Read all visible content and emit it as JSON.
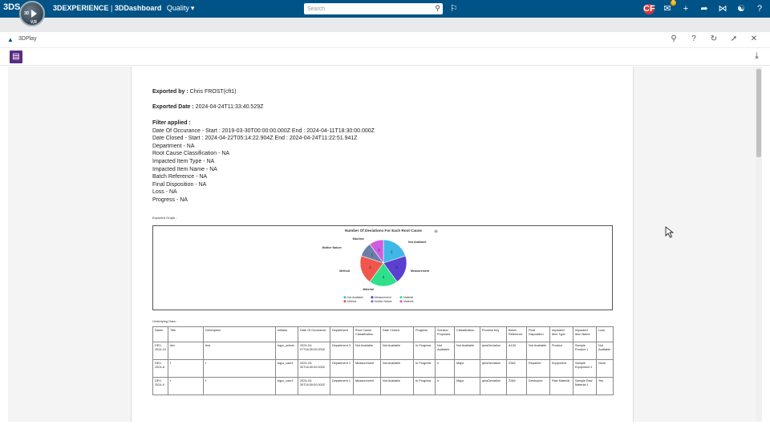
{
  "topbar": {
    "logo": "3DS",
    "compass": {
      "label_3d": "3D",
      "label_v": "V,R"
    },
    "title_brand": "3DEXPERIENCE",
    "title_sep": " | ",
    "title_app": "3DDashboard",
    "title_context": "Quality",
    "search_placeholder": "Search",
    "avatar_initials": "CF",
    "notification_count": "5"
  },
  "widget": {
    "title": "3DPlay"
  },
  "report": {
    "exported_by_label": "Exported by :",
    "exported_by_value": " Chris FROST(cft1)",
    "exported_date_label": "Exported Date :",
    "exported_date_value": " 2024-04-24T11:33:40.529Z",
    "filter_label": "Filter applied :",
    "filters": [
      "Date Of Occurance - Start : 2019-03-30T00:00:00.000Z End : 2024-04-11T18:30:00.000Z",
      "Date Closed - Start : 2024-04-22T05:14:22.904Z End : 2024-04-24T11:22:51.941Z",
      "Department - NA",
      "Root Cause Classification - NA",
      "Impacted Item Type - NA",
      "Impacted Item Name - NA",
      "Batch Reference - NA",
      "Final Disposition - NA",
      "Loss - NA",
      "Progress - NA"
    ],
    "graph_label": "Exported Graph :",
    "data_label": "Underlying Data :"
  },
  "chart_data": {
    "type": "pie",
    "title": "Number Of Deviations For Each Root Cause",
    "menu_icon": "hamburger-icon",
    "slices": [
      {
        "name": "Not Available",
        "value": 2,
        "color": "#3fb8e8"
      },
      {
        "name": "Measurement",
        "value": 2,
        "color": "#5b3fd0"
      },
      {
        "name": "Material",
        "value": 2,
        "color": "#2fe08a"
      },
      {
        "name": "Method",
        "value": 2,
        "color": "#f0564c"
      },
      {
        "name": "Mother Nature",
        "value": 1,
        "color": "#6a7fa8"
      },
      {
        "name": "Machine",
        "value": 1,
        "color": "#cf5ce0"
      }
    ],
    "legend_position": "bottom"
  },
  "table": {
    "headers": [
      "Name",
      "Title",
      "Description",
      "Initiator",
      "Date Of Occurance",
      "Department",
      "Root Cause Classification",
      "Date Closed",
      "Progress",
      "Solution Proposed",
      "Classification",
      "Process Key",
      "Batch Reference",
      "Final Disposition",
      "Impacted Item Type",
      "Impacted Item Name",
      "Loss"
    ],
    "rows": [
      [
        "DEV-2024-10",
        "dev",
        "test",
        "bqpc_admin",
        "2024-04-07T18:30:00.000Z",
        "Department 3",
        "Not Available",
        "Not Available",
        "In Progress",
        "Not Available",
        "Not Available",
        "qmsDeviation",
        "A133",
        "Not Available",
        "Product",
        "Sample Product 1",
        "Not Available"
      ],
      [
        "DEV-2024-8",
        "f",
        "f",
        "bqpc_user1",
        "2024-03-30T18:30:00.000Z",
        "Department 1",
        "Measurement",
        "Not Available",
        "In Progress",
        "rr",
        "Major",
        "qmsDeviation",
        "Z345",
        "Repaired",
        "Equipment",
        "Sample Equipment 1",
        "None"
      ],
      [
        "DEV-2024-9",
        "f",
        "f",
        "bqpc_user1",
        "2024-03-30T18:30:00.000Z",
        "Department 1",
        "Measurement",
        "Not Available",
        "In Progress",
        "rr",
        "Major",
        "qmsDeviation",
        "Z345",
        "Destroyed",
        "Raw Material",
        "Sample Raw Material 1",
        "Yes"
      ]
    ]
  }
}
